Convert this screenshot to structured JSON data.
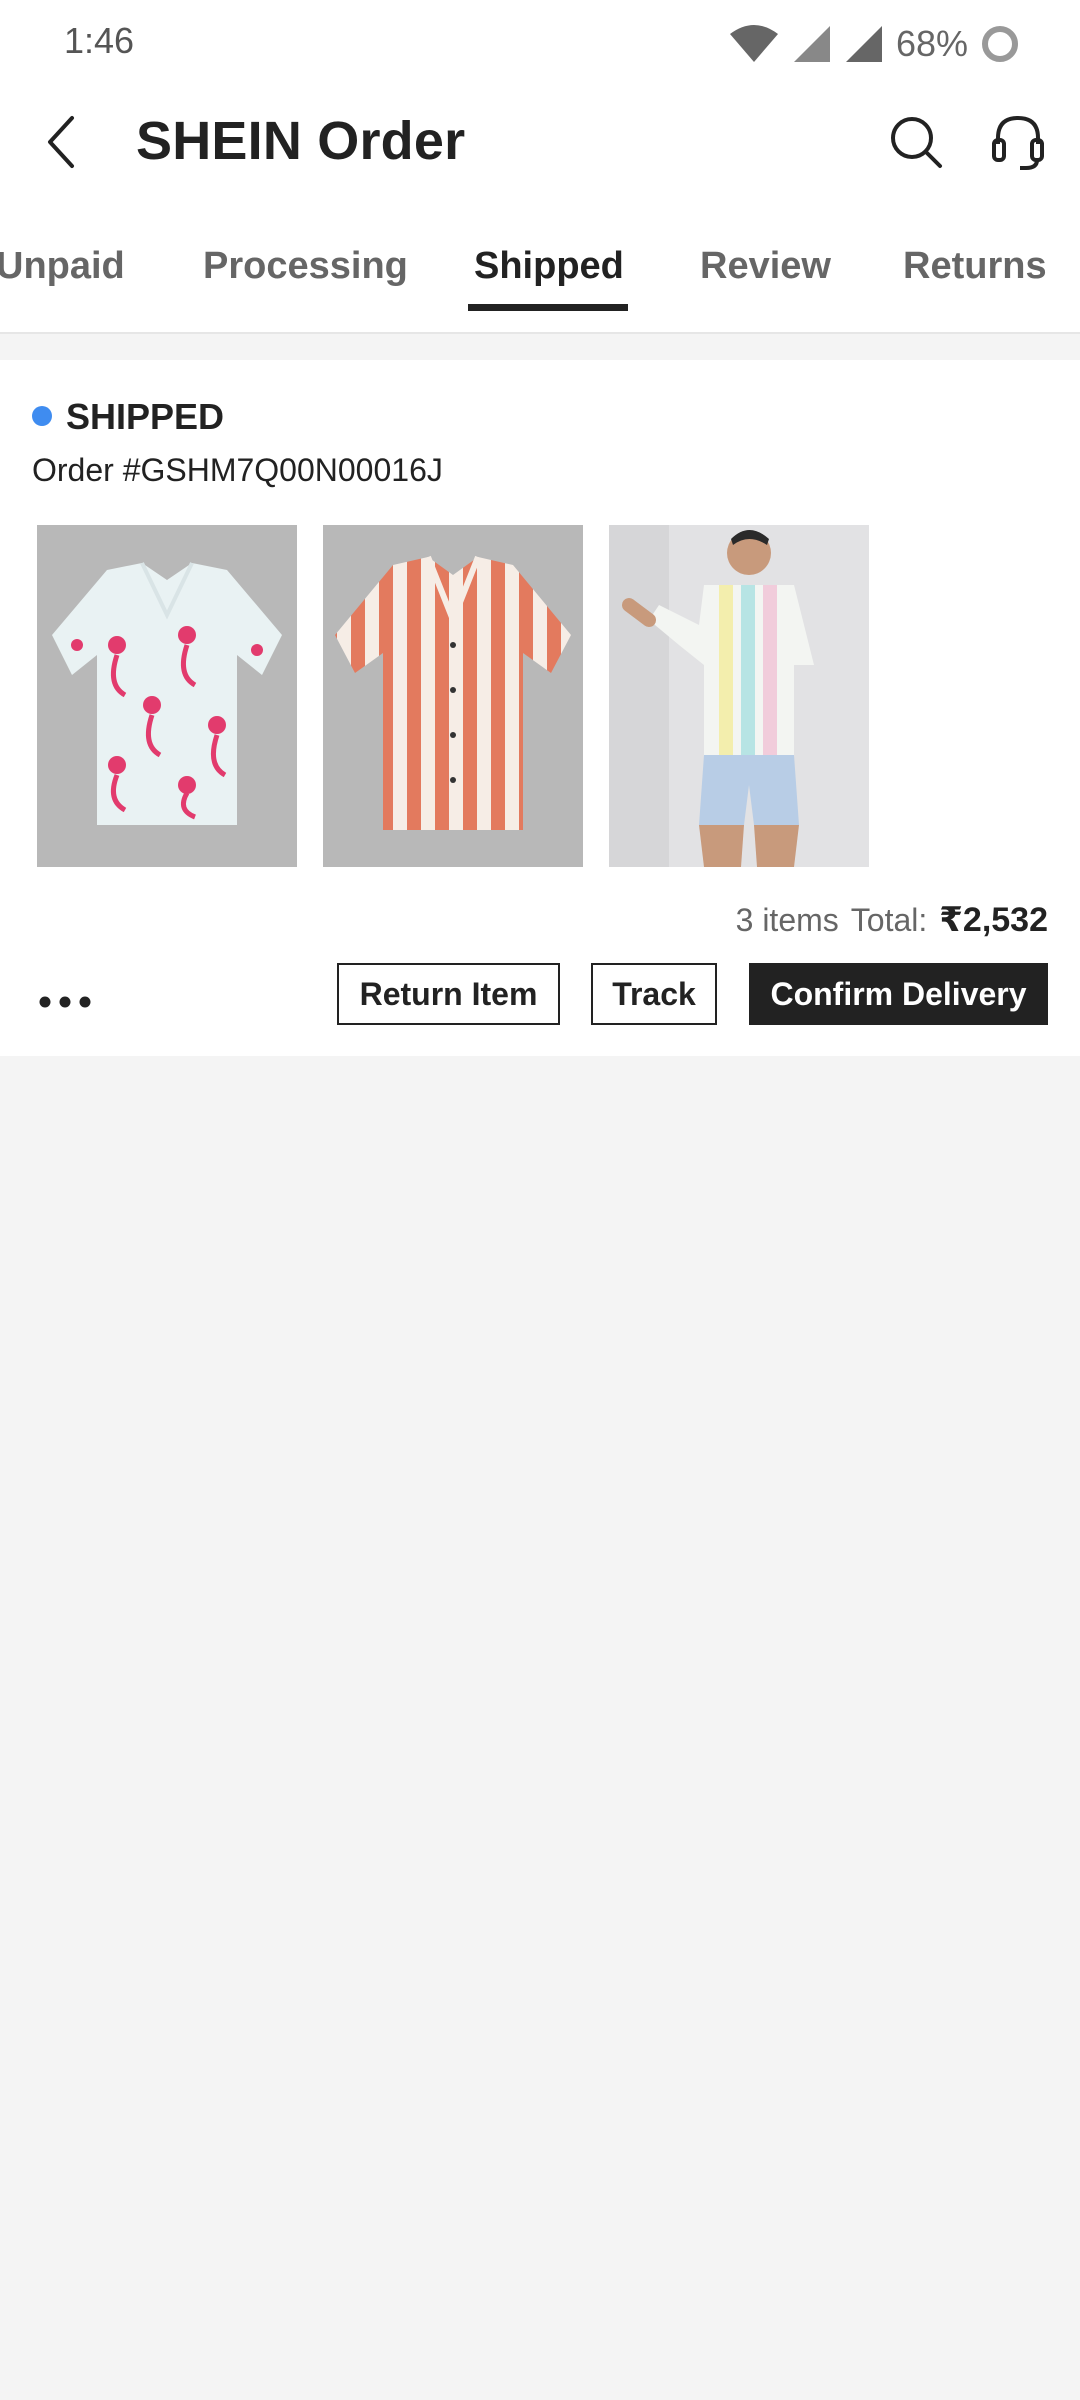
{
  "status_bar": {
    "time": "1:46",
    "battery": "68%",
    "icons": [
      "wifi-icon",
      "signal-icon",
      "signal-icon",
      "battery-icon"
    ]
  },
  "header": {
    "title": "SHEIN Order",
    "back_icon": "back-arrow-icon",
    "search_icon": "search-icon",
    "support_icon": "headset-icon"
  },
  "tabs": [
    {
      "label": "Unpaid",
      "active": false
    },
    {
      "label": "Processing",
      "active": false
    },
    {
      "label": "Shipped",
      "active": true
    },
    {
      "label": "Review",
      "active": false
    },
    {
      "label": "Returns",
      "active": false
    }
  ],
  "order": {
    "status": "SHIPPED",
    "status_color": "#3f8cf0",
    "order_number": "Order #GSHM7Q00N00016J",
    "items": [
      {
        "name": "flamingo print shirt"
      },
      {
        "name": "striped shirt"
      },
      {
        "name": "pastel striped shirt on model"
      }
    ],
    "item_count": "3 items",
    "total_label": "Total:",
    "total_value": "₹2,532",
    "actions": {
      "more_icon": "more-dots-icon",
      "return_label": "Return Item",
      "track_label": "Track",
      "confirm_label": "Confirm Delivery"
    }
  },
  "colors": {
    "background": "#f4f4f4",
    "text": "#222222",
    "accent_dark": "#222222"
  }
}
